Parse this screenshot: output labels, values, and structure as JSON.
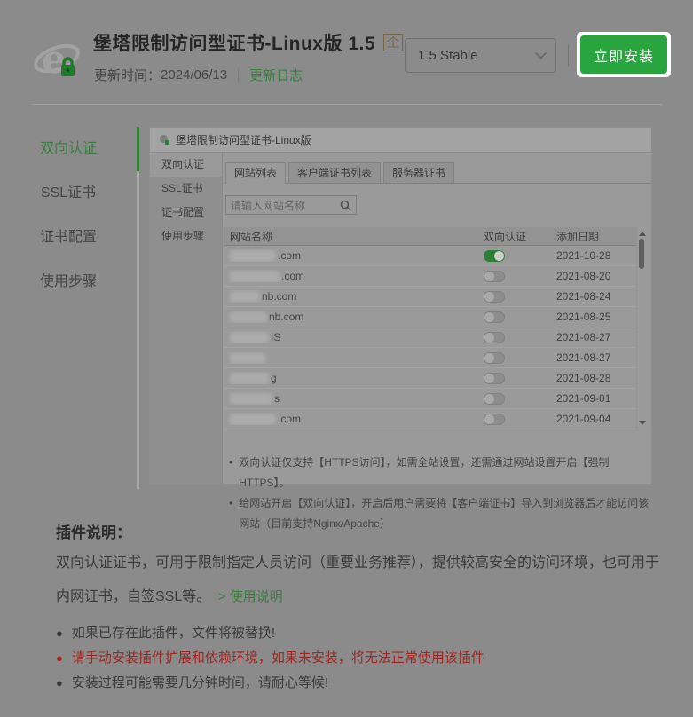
{
  "colors": {
    "page_bg": "#8b8b8b",
    "accent_green": "#28a53e",
    "link_green": "#3b7d41",
    "badge_gold": "#776449",
    "warning_red": "#9c2722",
    "toggle_on_green": "#2e7d39"
  },
  "header": {
    "title": "堡塔限制访问型证书-Linux版 1.5",
    "badge": "企",
    "update_time_label": "更新时间：",
    "update_time": "2024/06/13",
    "changelog_label": "更新日志",
    "version_selected": "1.5 Stable",
    "install_label": "立即安装"
  },
  "sidebar": {
    "items": [
      {
        "label": "双向认证",
        "active": true
      },
      {
        "label": "SSL证书",
        "active": false
      },
      {
        "label": "证书配置",
        "active": false
      },
      {
        "label": "使用步骤",
        "active": false
      }
    ]
  },
  "preview": {
    "window_title": "堡塔限制访问型证书-Linux版",
    "sidebar_items": [
      {
        "label": "双向认证",
        "active": true
      },
      {
        "label": "SSL证书",
        "active": false
      },
      {
        "label": "证书配置",
        "active": false
      },
      {
        "label": "使用步骤",
        "active": false
      }
    ],
    "tabs": [
      {
        "label": "网站列表",
        "active": true
      },
      {
        "label": "客户端证书列表",
        "active": false
      },
      {
        "label": "服务器证书",
        "active": false
      }
    ],
    "search_placeholder": "请输入网站名称",
    "table": {
      "columns": [
        "网站名称",
        "双向认证",
        "添加日期"
      ],
      "rows": [
        {
          "name_fragment": ".com",
          "blur_width": 52,
          "toggle_on": true,
          "date": "2021-10-28"
        },
        {
          "name_fragment": ".com",
          "blur_width": 56,
          "toggle_on": false,
          "date": "2021-08-20"
        },
        {
          "name_fragment": "nb.com",
          "blur_width": 34,
          "toggle_on": false,
          "date": "2021-08-24"
        },
        {
          "name_fragment": "nb.com",
          "blur_width": 42,
          "toggle_on": false,
          "date": "2021-08-25"
        },
        {
          "name_fragment": "IS",
          "blur_width": 44,
          "toggle_on": false,
          "date": "2021-08-27"
        },
        {
          "name_fragment": "",
          "blur_width": 40,
          "toggle_on": false,
          "date": "2021-08-27"
        },
        {
          "name_fragment": "g",
          "blur_width": 44,
          "toggle_on": false,
          "date": "2021-08-28"
        },
        {
          "name_fragment": "s",
          "blur_width": 48,
          "toggle_on": false,
          "date": "2021-09-01"
        },
        {
          "name_fragment": ".com",
          "blur_width": 52,
          "toggle_on": false,
          "date": "2021-09-04"
        }
      ]
    },
    "notes": [
      "双向认证仅支持【HTTPS访问】，如需全站设置，还需通过网站设置开启【强制HTTPS】。",
      "给网站开启【双向认证】，开启后用户需要将【客户端证书】导入到浏览器后才能访问该网站（目前支持Nginx/Apache）"
    ]
  },
  "description": {
    "heading": "插件说明：",
    "body": "双向认证证书，可用于限制指定人员访问（重要业务推荐），提供较高安全的访问环境，也可用于内网证书，自签SSL等。",
    "usage_link": "> 使用说明",
    "bullets": [
      {
        "text": "如果已存在此插件，文件将被替换!",
        "red": false
      },
      {
        "text": "请手动安装插件扩展和依赖环境，如果未安装，将无法正常使用该插件",
        "red": true
      },
      {
        "text": "安装过程可能需要几分钟时间，请耐心等候!",
        "red": false
      }
    ]
  }
}
